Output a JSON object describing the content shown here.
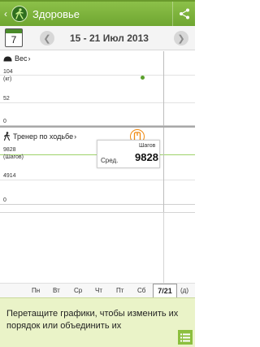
{
  "app": {
    "title": "Здоровье"
  },
  "date_nav": {
    "calendar_day": "7",
    "range": "15 - 21 Июл 2013"
  },
  "weight_chart": {
    "title": "Вес",
    "y_labels": {
      "top": "104",
      "top_unit": "(кг)",
      "mid": "52",
      "zero": "0"
    }
  },
  "walking_chart": {
    "title": "Тренер по ходьбе",
    "y_labels": {
      "top": "9828",
      "top_unit": "(Шагов)",
      "mid": "4914",
      "zero": "0"
    },
    "tooltip": {
      "unit": "Шагов",
      "label": "Сред.",
      "value": "9828"
    }
  },
  "days": {
    "labels": [
      "Пн",
      "Вт",
      "Ср",
      "Чт",
      "Пт",
      "Сб"
    ],
    "current_date": "7/21",
    "unit": "(д)"
  },
  "hint": {
    "text": "Перетащите графики, чтобы изменить их порядок или объединить их"
  },
  "colors": {
    "accent": "#7cb342",
    "point": "#5aa02c",
    "walk_line": "#9ed36a"
  }
}
